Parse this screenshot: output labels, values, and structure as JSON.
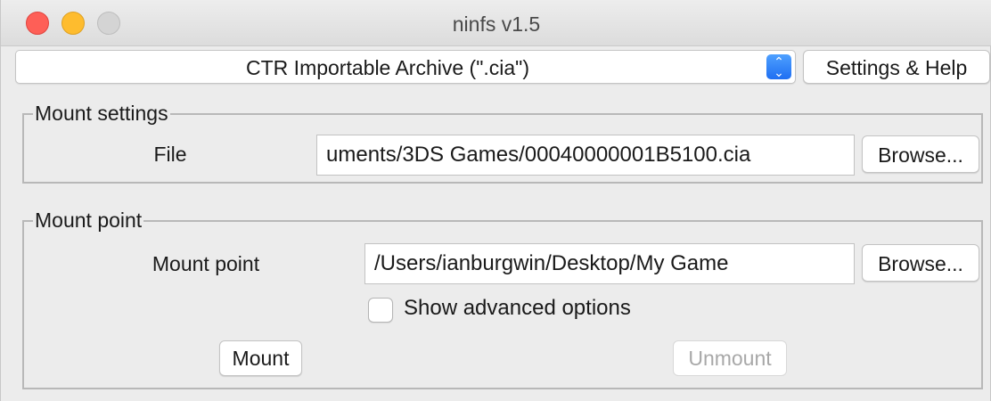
{
  "window": {
    "title": "ninfs v1.5"
  },
  "toolbar": {
    "archive_type_selected": "CTR Importable Archive (\".cia\")",
    "settings_help_label": "Settings & Help"
  },
  "mount_settings": {
    "group_label": "Mount settings",
    "file_label": "File",
    "file_value": "uments/3DS Games/00040000001B5100.cia",
    "browse_label": "Browse..."
  },
  "mount_point": {
    "group_label": "Mount point",
    "field_label": "Mount point",
    "field_value": "/Users/ianburgwin/Desktop/My Game",
    "browse_label": "Browse...",
    "advanced_label": "Show advanced options",
    "advanced_checked": false,
    "mount_label": "Mount",
    "unmount_label": "Unmount"
  },
  "colors": {
    "close": "#fe5f57",
    "minimize": "#febc2e",
    "zoom_inactive": "#d4d4d4",
    "accent": "#1f6ff2",
    "disabled_text": "#a8a8a8"
  }
}
